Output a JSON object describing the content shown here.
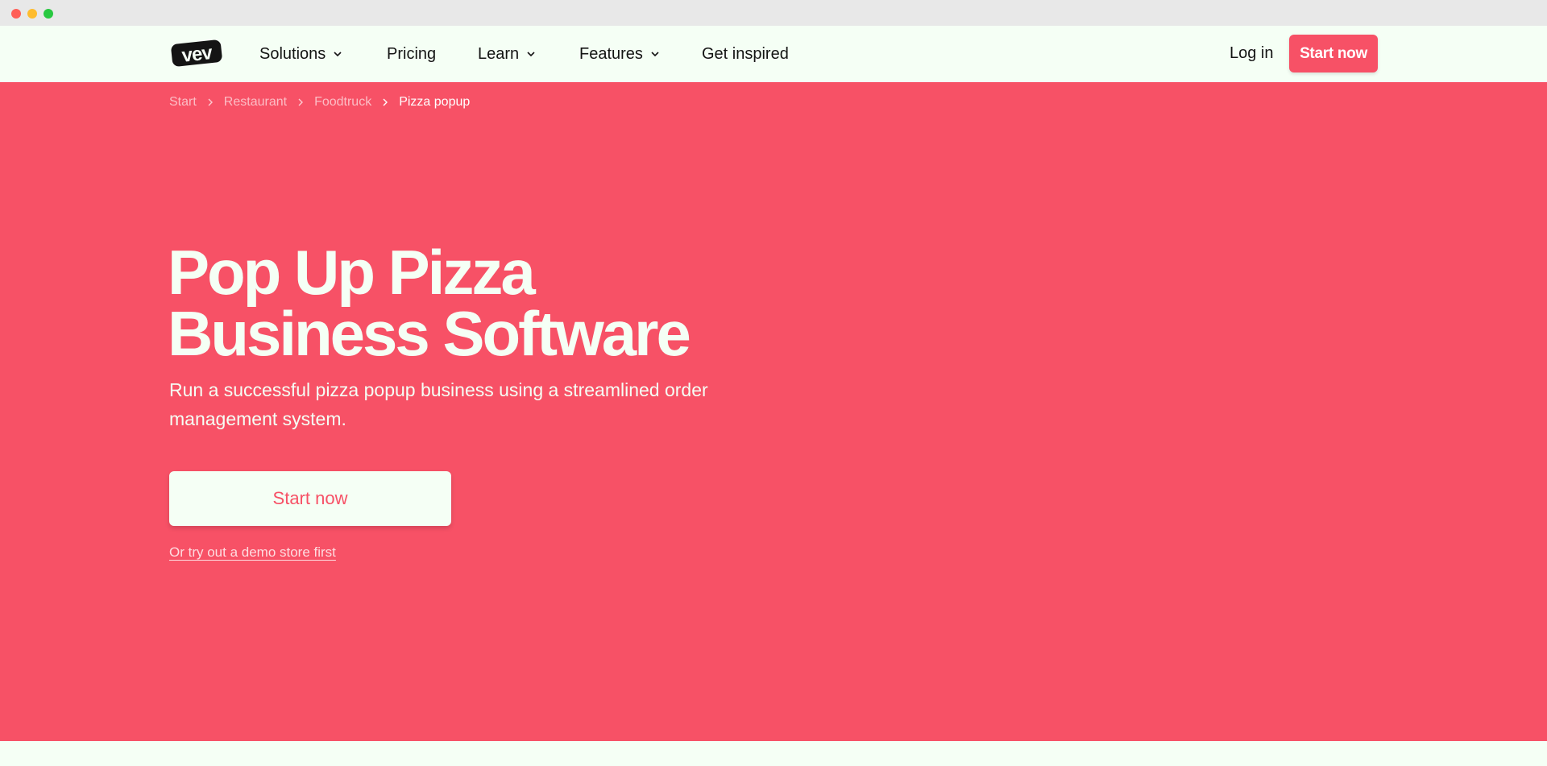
{
  "nav": {
    "logo_text": "vev",
    "items": [
      {
        "label": "Solutions",
        "has_dropdown": true
      },
      {
        "label": "Pricing",
        "has_dropdown": false
      },
      {
        "label": "Learn",
        "has_dropdown": true
      },
      {
        "label": "Features",
        "has_dropdown": true
      },
      {
        "label": "Get inspired",
        "has_dropdown": false
      }
    ],
    "login_label": "Log in",
    "cta_label": "Start now"
  },
  "breadcrumb": [
    "Start",
    "Restaurant",
    "Foodtruck",
    "Pizza popup"
  ],
  "hero": {
    "title_line1": "Pop Up Pizza",
    "title_line2": "Business Software",
    "subtitle": "Run a successful pizza popup business using a streamlined order management system.",
    "cta_label": "Start now",
    "demo_link": "Or try out a demo store first"
  },
  "icons": {
    "dropdown": "chevron-down-icon",
    "separator": "chevron-right-icon"
  },
  "colors": {
    "brand": "#f75166",
    "background": "#f5fff5",
    "text": "#141414"
  }
}
